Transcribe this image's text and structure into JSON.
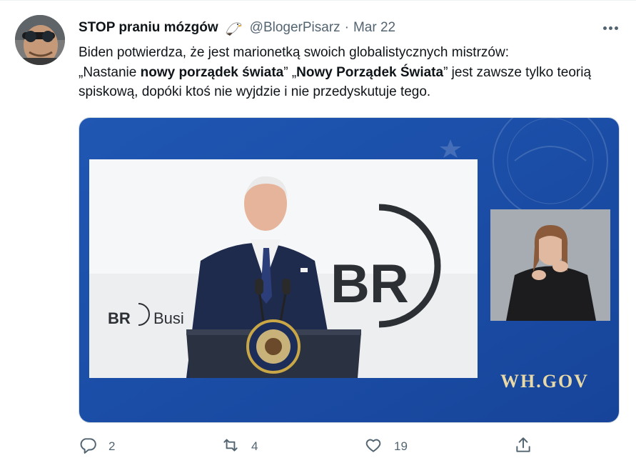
{
  "tweet": {
    "author_name": "STOP praniu mózgów",
    "author_emoji": "🦅",
    "handle": "@BlogerPisarz",
    "separator": "·",
    "date": "Mar 22",
    "text": {
      "line1": "Biden potwierdza, że jest marionetką swoich globalistycznych mistrzów:",
      "quote_open1": "„Nastanie ",
      "bold1": "nowy porządek świata",
      "quote_close1": "” ",
      "quote_open2": "„",
      "bold2": "Nowy Porządek Świata",
      "rest": "” jest zawsze tylko teorią spiskową, dopóki ktoś nie wyjdzie i nie przedyskutuje tego."
    }
  },
  "media": {
    "logo_text": "BR",
    "sign_text": "Busi",
    "brand_text": "BR",
    "watermark": "WH.GOV"
  },
  "actions": {
    "reply_count": "2",
    "retweet_count": "4",
    "like_count": "19",
    "reply_icon": "reply-icon",
    "retweet_icon": "retweet-icon",
    "like_icon": "like-icon",
    "share_icon": "share-icon"
  },
  "colors": {
    "text": "#0f1419",
    "secondary": "#536471",
    "media_blue": "#1d4fa6",
    "watermark": "#e8d9a6"
  }
}
